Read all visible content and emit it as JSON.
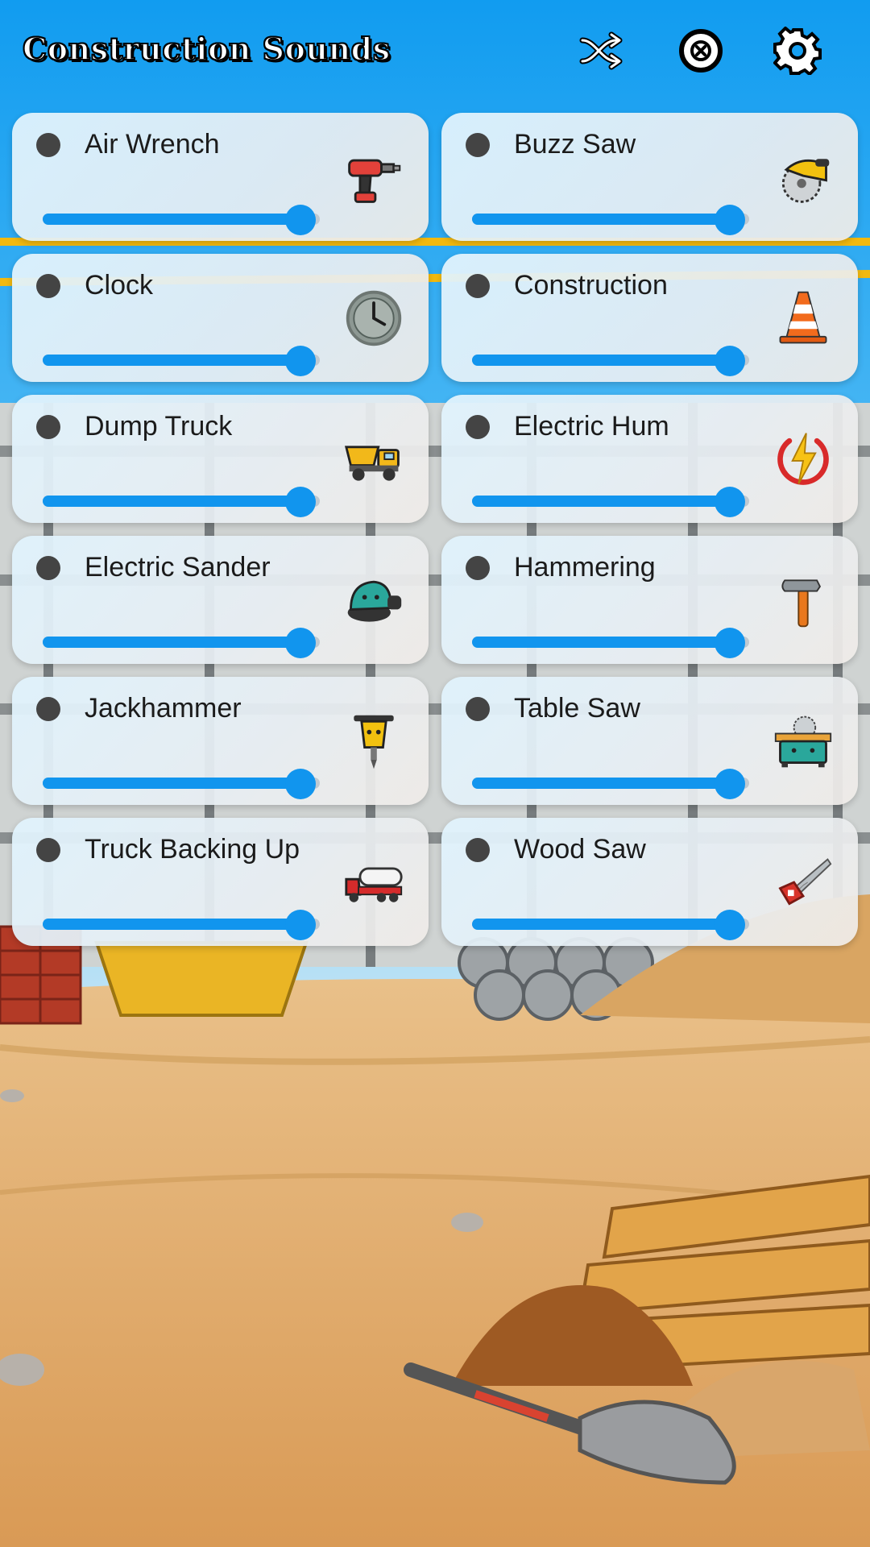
{
  "header": {
    "title": "Construction Sounds",
    "buttons": [
      {
        "name": "shuffle-button",
        "icon": "shuffle-icon"
      },
      {
        "name": "stop-all-button",
        "icon": "close-circle-icon"
      },
      {
        "name": "settings-button",
        "icon": "gear-icon"
      }
    ]
  },
  "colors": {
    "accent": "#1195ee",
    "sky": "#16a0f2",
    "ground": "#e2ad6b",
    "indicator": "#444444"
  },
  "sounds": [
    {
      "label": "Air Wrench",
      "icon": "air-wrench-icon",
      "volume": 0.93
    },
    {
      "label": "Buzz Saw",
      "icon": "circular-saw-icon",
      "volume": 0.93
    },
    {
      "label": "Clock",
      "icon": "clock-icon",
      "volume": 0.93
    },
    {
      "label": "Construction",
      "icon": "traffic-cone-icon",
      "volume": 0.93
    },
    {
      "label": "Dump Truck",
      "icon": "dump-truck-icon",
      "volume": 0.93
    },
    {
      "label": "Electric Hum",
      "icon": "lightning-icon",
      "volume": 0.93
    },
    {
      "label": "Electric Sander",
      "icon": "sander-icon",
      "volume": 0.93
    },
    {
      "label": "Hammering",
      "icon": "hammer-icon",
      "volume": 0.93
    },
    {
      "label": "Jackhammer",
      "icon": "jackhammer-icon",
      "volume": 0.93
    },
    {
      "label": "Table Saw",
      "icon": "table-saw-icon",
      "volume": 0.93
    },
    {
      "label": "Truck Backing Up",
      "icon": "truck-icon",
      "volume": 0.93
    },
    {
      "label": "Wood Saw",
      "icon": "hand-saw-icon",
      "volume": 0.93
    }
  ]
}
